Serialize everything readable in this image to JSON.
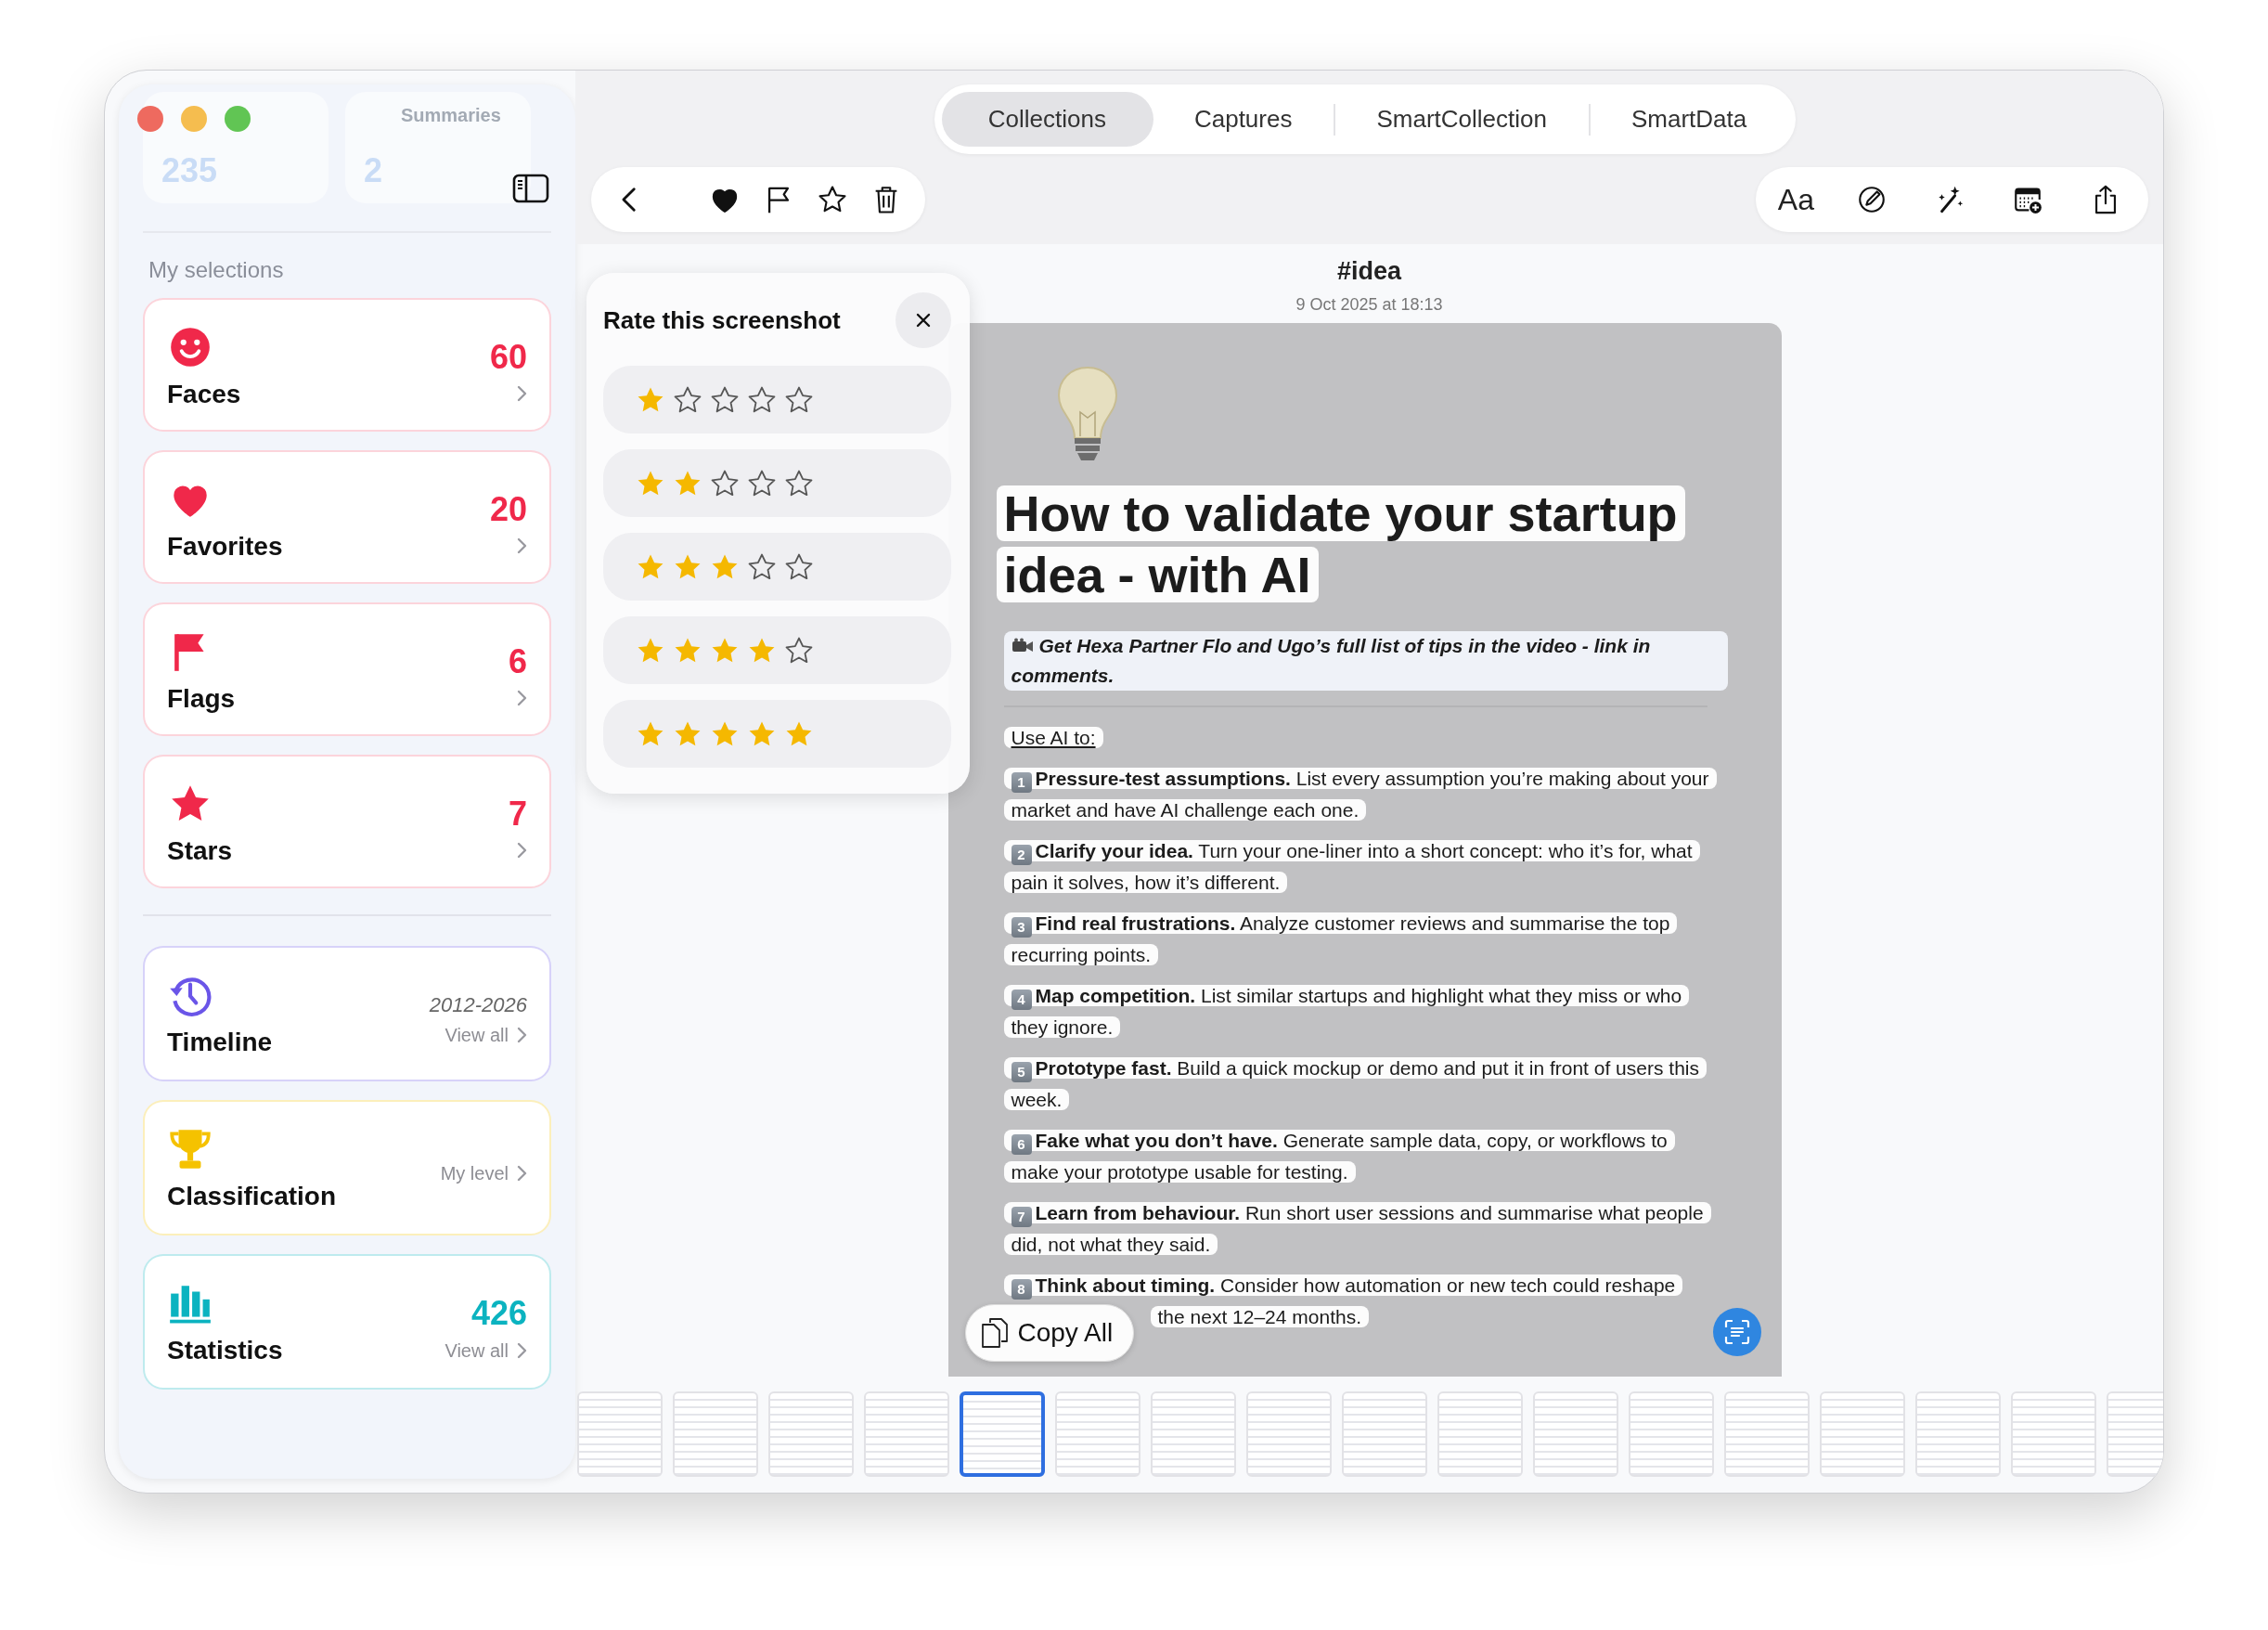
{
  "sidebar": {
    "top_cards": [
      {
        "value": "235"
      },
      {
        "label": "Summaries",
        "value": "2"
      }
    ],
    "section_title": "My selections",
    "selections": [
      {
        "kind": "faces",
        "title": "Faces",
        "count": "60",
        "color": "#f0284a"
      },
      {
        "kind": "favorites",
        "title": "Favorites",
        "count": "20",
        "color": "#f0284a"
      },
      {
        "kind": "flags",
        "title": "Flags",
        "count": "6",
        "color": "#f0284a"
      },
      {
        "kind": "stars",
        "title": "Stars",
        "count": "7",
        "color": "#f0284a"
      }
    ],
    "overviews": [
      {
        "kind": "timeline",
        "title": "Timeline",
        "detail": "2012-2026",
        "link": "View all",
        "color": "#6a55e8"
      },
      {
        "kind": "classification",
        "title": "Classification",
        "link": "My level",
        "color": "#f5c200"
      },
      {
        "kind": "statistics",
        "title": "Statistics",
        "count": "426",
        "link": "View all",
        "color": "#0bb3c0"
      }
    ]
  },
  "tabs": [
    {
      "label": "Collections",
      "selected": true
    },
    {
      "label": "Captures",
      "selected": false
    },
    {
      "label": "SmartCollection",
      "selected": false
    },
    {
      "label": "SmartData",
      "selected": false
    }
  ],
  "toolbar": {
    "favorite": true,
    "flagged": false,
    "starred": false,
    "text_button": "Aa"
  },
  "item": {
    "title": "#idea",
    "date": "9 Oct 2025 at 18:13"
  },
  "rating_popover": {
    "title": "Rate this screenshot",
    "options": [
      {
        "stars": 1
      },
      {
        "stars": 2
      },
      {
        "stars": 3
      },
      {
        "stars": 4
      },
      {
        "stars": 5
      }
    ]
  },
  "screenshot": {
    "title": "How to validate your startup idea - with AI",
    "subtitle": "Get Hexa Partner Flo and Ugo’s full list of tips in the video - link in comments.",
    "intro": "Use AI to:",
    "items": [
      {
        "number": "1",
        "text": "**Pressure-test assumptions.** List every assumption you’re making about your market and have AI challenge each one."
      },
      {
        "number": "2",
        "text": "**Clarify your idea.** Turn your one-liner into a short concept: who it’s for, what pain it solves, how it’s different."
      },
      {
        "number": "3",
        "text": "**Find real frustrations.** Analyze customer reviews and summarise the top recurring points."
      },
      {
        "number": "4",
        "text": "**Map competition.** List similar startups and highlight what they miss or who they ignore."
      },
      {
        "number": "5",
        "text": "**Prototype fast.** Build a quick mockup or demo and put it in front of users this week."
      },
      {
        "number": "6",
        "text": "**Fake what you don’t have.** Generate sample data, copy, or workflows to make your prototype usable for testing."
      },
      {
        "number": "7",
        "text": "**Learn from behaviour.** Run short user sessions and summarise what people did, not what they said."
      },
      {
        "number": "8",
        "text": "**Think about timing.** Consider how automation or new tech could reshape",
        "continuation": "the next 12–24 months."
      }
    ]
  },
  "copy_button": "Copy All",
  "thumbnails": [
    {
      "selected": false
    },
    {
      "selected": false
    },
    {
      "selected": false
    },
    {
      "selected": false
    },
    {
      "selected": true
    },
    {
      "selected": false
    },
    {
      "selected": false
    },
    {
      "selected": false
    },
    {
      "selected": false
    },
    {
      "selected": false
    },
    {
      "selected": false
    },
    {
      "selected": false
    },
    {
      "selected": false
    },
    {
      "selected": false
    },
    {
      "selected": false
    },
    {
      "selected": false
    },
    {
      "selected": false
    }
  ]
}
